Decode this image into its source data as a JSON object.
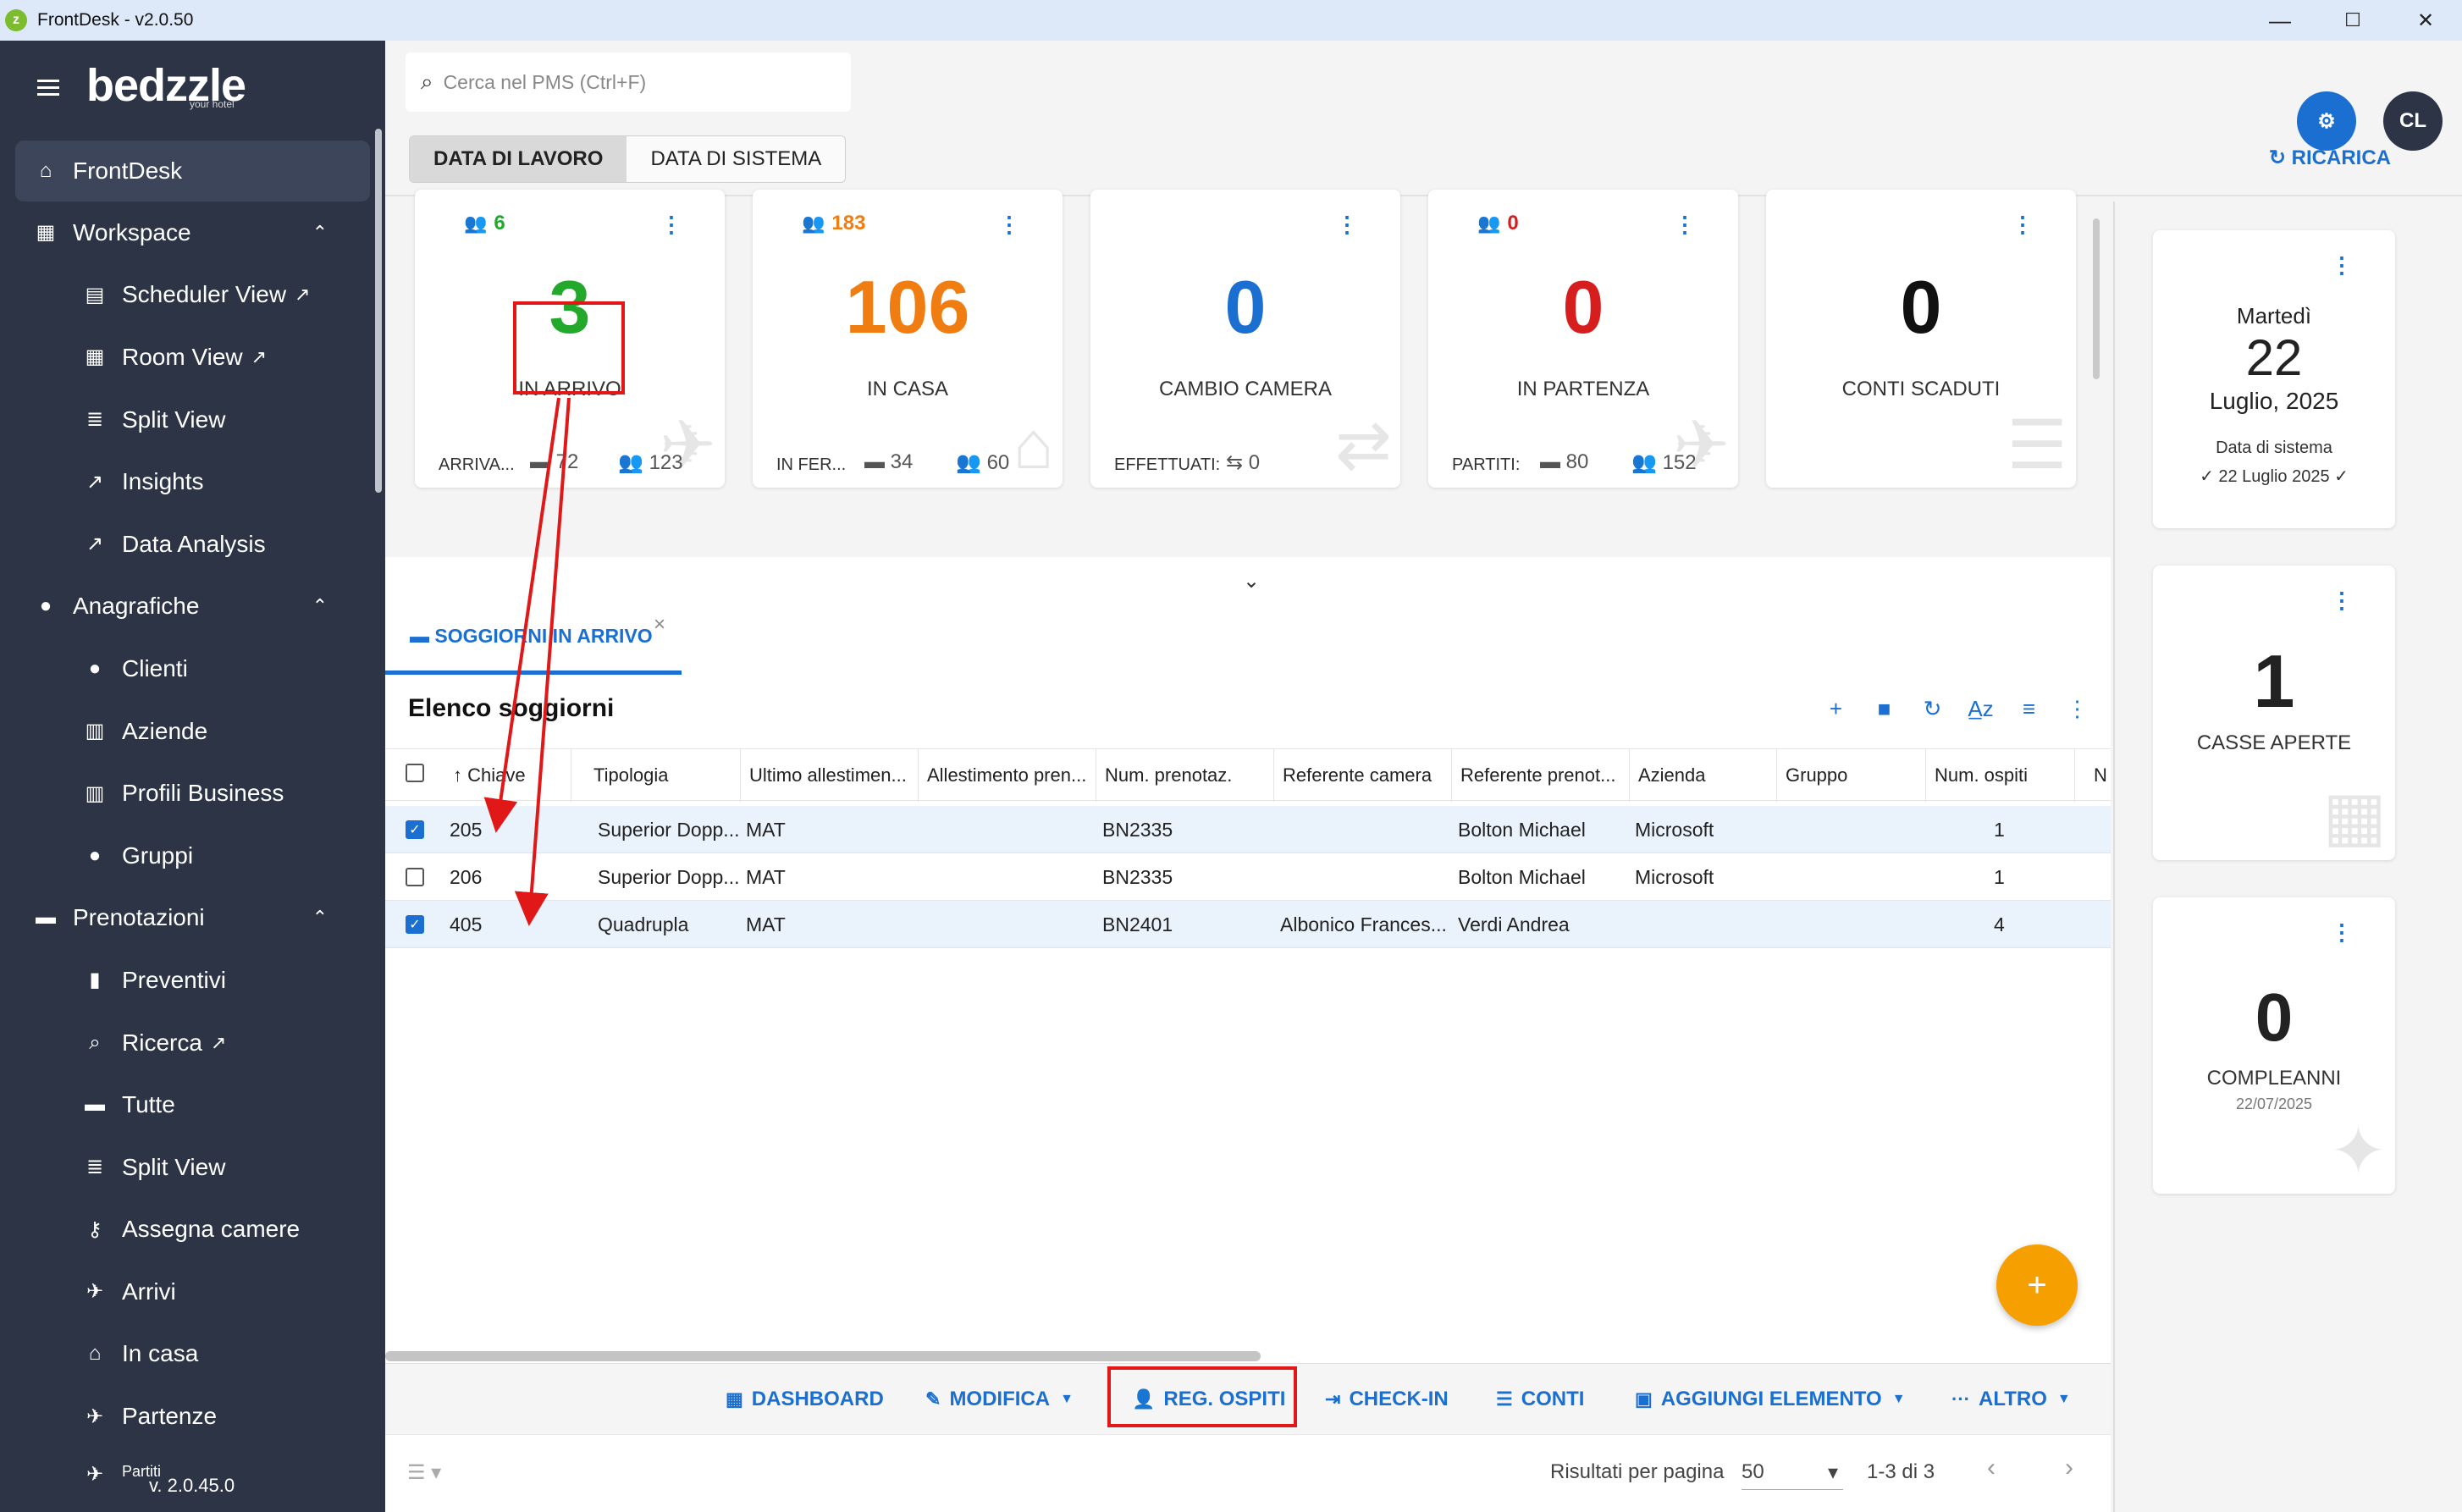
{
  "window": {
    "title": "FrontDesk - v2.0.50",
    "minimize": "—",
    "maximize": "☐",
    "close": "✕"
  },
  "sidebar": {
    "logo": "bedzzle",
    "logo_sub": "your hotel",
    "version": "v. 2.0.45.0",
    "items": [
      {
        "label": "FrontDesk"
      },
      {
        "label": "Workspace"
      },
      {
        "label": "Scheduler View"
      },
      {
        "label": "Room View"
      },
      {
        "label": "Split View"
      },
      {
        "label": "Insights"
      },
      {
        "label": "Data Analysis"
      },
      {
        "label": "Anagrafiche"
      },
      {
        "label": "Clienti"
      },
      {
        "label": "Aziende"
      },
      {
        "label": "Profili Business"
      },
      {
        "label": "Gruppi"
      },
      {
        "label": "Prenotazioni"
      },
      {
        "label": "Preventivi"
      },
      {
        "label": "Ricerca"
      },
      {
        "label": "Tutte"
      },
      {
        "label": "Split View"
      },
      {
        "label": "Assegna camere"
      },
      {
        "label": "Arrivi"
      },
      {
        "label": "In casa"
      },
      {
        "label": "Partenze"
      },
      {
        "label": "Partiti"
      }
    ]
  },
  "header": {
    "search_placeholder": "Cerca nel PMS (Ctrl+F)",
    "toggle": [
      "DATA DI LAVORO",
      "DATA DI SISTEMA"
    ],
    "reload": "RICARICA",
    "avatar": "CL"
  },
  "cards": [
    {
      "count": "6",
      "value": "3",
      "label": "IN ARRIVO",
      "foot_label": "ARRIVA...",
      "foot_a": "72",
      "foot_b": "123"
    },
    {
      "count": "183",
      "value": "106",
      "label": "IN CASA",
      "foot_label": "IN FER...",
      "foot_a": "34",
      "foot_b": "60"
    },
    {
      "value": "0",
      "label": "CAMBIO CAMERA",
      "foot_label": "EFFETTUATI:",
      "foot_a": "0"
    },
    {
      "count": "0",
      "value": "0",
      "label": "IN PARTENZA",
      "foot_label": "PARTITI:",
      "foot_a": "80",
      "foot_b": "152"
    },
    {
      "value": "0",
      "label": "CONTI SCADUTI"
    }
  ],
  "side_cards": {
    "date": {
      "weekday": "Martedì",
      "day": "22",
      "month_year": "Luglio, 2025",
      "sys_label": "Data di sistema",
      "sys_value": "✓ 22 Luglio 2025 ✓"
    },
    "cash": {
      "value": "1",
      "label": "CASSE APERTE"
    },
    "birthdays": {
      "value": "0",
      "label": "COMPLEANNI",
      "date": "22/07/2025"
    }
  },
  "stays": {
    "tab": "SOGGIORNI IN ARRIVO",
    "title": "Elenco soggiorni",
    "columns": [
      "Chiave",
      "Tipologia",
      "Ultimo allestimen...",
      "Allestimento pren...",
      "Num. prenotaz.",
      "Referente camera",
      "Referente prenot...",
      "Azienda",
      "Gruppo",
      "Num. ospiti",
      "N"
    ],
    "rows": [
      {
        "key": "205",
        "type": "Superior Dopp...",
        "last": "MAT",
        "booked": "",
        "num": "BN2335",
        "room_ref": "",
        "booking_ref": "Bolton Michael",
        "company": "Microsoft",
        "group": "",
        "guests": "1"
      },
      {
        "key": "206",
        "type": "Superior Dopp...",
        "last": "MAT",
        "booked": "",
        "num": "BN2335",
        "room_ref": "",
        "booking_ref": "Bolton Michael",
        "company": "Microsoft",
        "group": "",
        "guests": "1"
      },
      {
        "key": "405",
        "type": "Quadrupla",
        "last": "MAT",
        "booked": "",
        "num": "BN2401",
        "room_ref": "Albonico Frances...",
        "booking_ref": "Verdi Andrea",
        "company": "",
        "group": "",
        "guests": "4"
      }
    ],
    "actions": [
      "DASHBOARD",
      "MODIFICA",
      "REG. OSPITI",
      "CHECK-IN",
      "CONTI",
      "AGGIUNGI ELEMENTO",
      "ALTRO"
    ],
    "pager": {
      "per_page_label": "Risultati per pagina",
      "per_page": "50",
      "range": "1-3 di 3"
    }
  },
  "colors": {
    "green": "#22a82b",
    "orange": "#f07d12",
    "blue": "#1a6fd1",
    "red": "#d71e1e",
    "sidebar": "#2c3446",
    "annotation": "#e01818"
  }
}
